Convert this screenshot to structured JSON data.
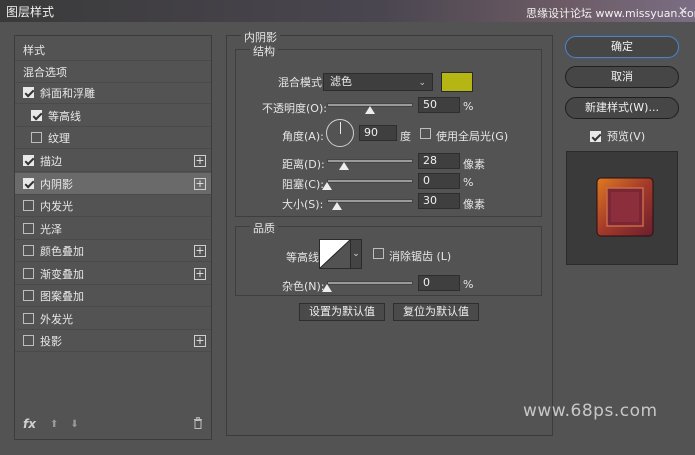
{
  "window": {
    "title": "图层样式",
    "watermark_top": "思缘设计论坛 www.missyuan.com",
    "close_glyph": "✕"
  },
  "sidebar": {
    "items": [
      {
        "label": "样式",
        "checkbox": null,
        "checked": false,
        "plus": false,
        "selected": false,
        "indent": false
      },
      {
        "label": "混合选项",
        "checkbox": null,
        "checked": false,
        "plus": false,
        "selected": false,
        "indent": false
      },
      {
        "label": "斜面和浮雕",
        "checkbox": true,
        "checked": true,
        "plus": false,
        "selected": false,
        "indent": false
      },
      {
        "label": "等高线",
        "checkbox": true,
        "checked": true,
        "plus": false,
        "selected": false,
        "indent": true
      },
      {
        "label": "纹理",
        "checkbox": true,
        "checked": false,
        "plus": false,
        "selected": false,
        "indent": true
      },
      {
        "label": "描边",
        "checkbox": true,
        "checked": true,
        "plus": true,
        "selected": false,
        "indent": false
      },
      {
        "label": "内阴影",
        "checkbox": true,
        "checked": true,
        "plus": true,
        "selected": true,
        "indent": false
      },
      {
        "label": "内发光",
        "checkbox": true,
        "checked": false,
        "plus": false,
        "selected": false,
        "indent": false
      },
      {
        "label": "光泽",
        "checkbox": true,
        "checked": false,
        "plus": false,
        "selected": false,
        "indent": false
      },
      {
        "label": "颜色叠加",
        "checkbox": true,
        "checked": false,
        "plus": true,
        "selected": false,
        "indent": false
      },
      {
        "label": "渐变叠加",
        "checkbox": true,
        "checked": false,
        "plus": true,
        "selected": false,
        "indent": false
      },
      {
        "label": "图案叠加",
        "checkbox": true,
        "checked": false,
        "plus": false,
        "selected": false,
        "indent": false
      },
      {
        "label": "外发光",
        "checkbox": true,
        "checked": false,
        "plus": false,
        "selected": false,
        "indent": false
      },
      {
        "label": "投影",
        "checkbox": true,
        "checked": false,
        "plus": true,
        "selected": false,
        "indent": false
      }
    ],
    "footer": {
      "fx": "fx",
      "up": "⬆",
      "down": "⬇"
    }
  },
  "panel": {
    "title": "内阴影",
    "structure": {
      "legend": "结构",
      "blend_mode_label": "混合模式：",
      "blend_mode_value": "滤色",
      "color": "#b5b514",
      "opacity_label": "不透明度(O):",
      "opacity_value": "50",
      "opacity_fraction": 0.5,
      "opacity_unit": "%",
      "angle_label": "角度(A):",
      "angle_value": "90",
      "angle_unit": "度",
      "global_light_label": "使用全局光(G)",
      "distance_label": "距离(D):",
      "distance_value": "28",
      "distance_fraction": 0.2,
      "distance_unit": "像素",
      "choke_label": "阻塞(C):",
      "choke_value": "0",
      "choke_fraction": 0.0,
      "choke_unit": "%",
      "size_label": "大小(S):",
      "size_value": "30",
      "size_fraction": 0.12,
      "size_unit": "像素"
    },
    "quality": {
      "legend": "品质",
      "contour_label": "等高线:",
      "antialias_label": "消除锯齿 (L)",
      "noise_label": "杂色(N):",
      "noise_value": "0",
      "noise_fraction": 0.0,
      "noise_unit": "%"
    },
    "set_default": "设置为默认值",
    "reset_default": "复位为默认值"
  },
  "actions": {
    "ok": "确定",
    "cancel": "取消",
    "new_style": "新建样式(W)...",
    "preview_label": "预览(V)"
  },
  "watermark_bottom": "www.68ps.com"
}
